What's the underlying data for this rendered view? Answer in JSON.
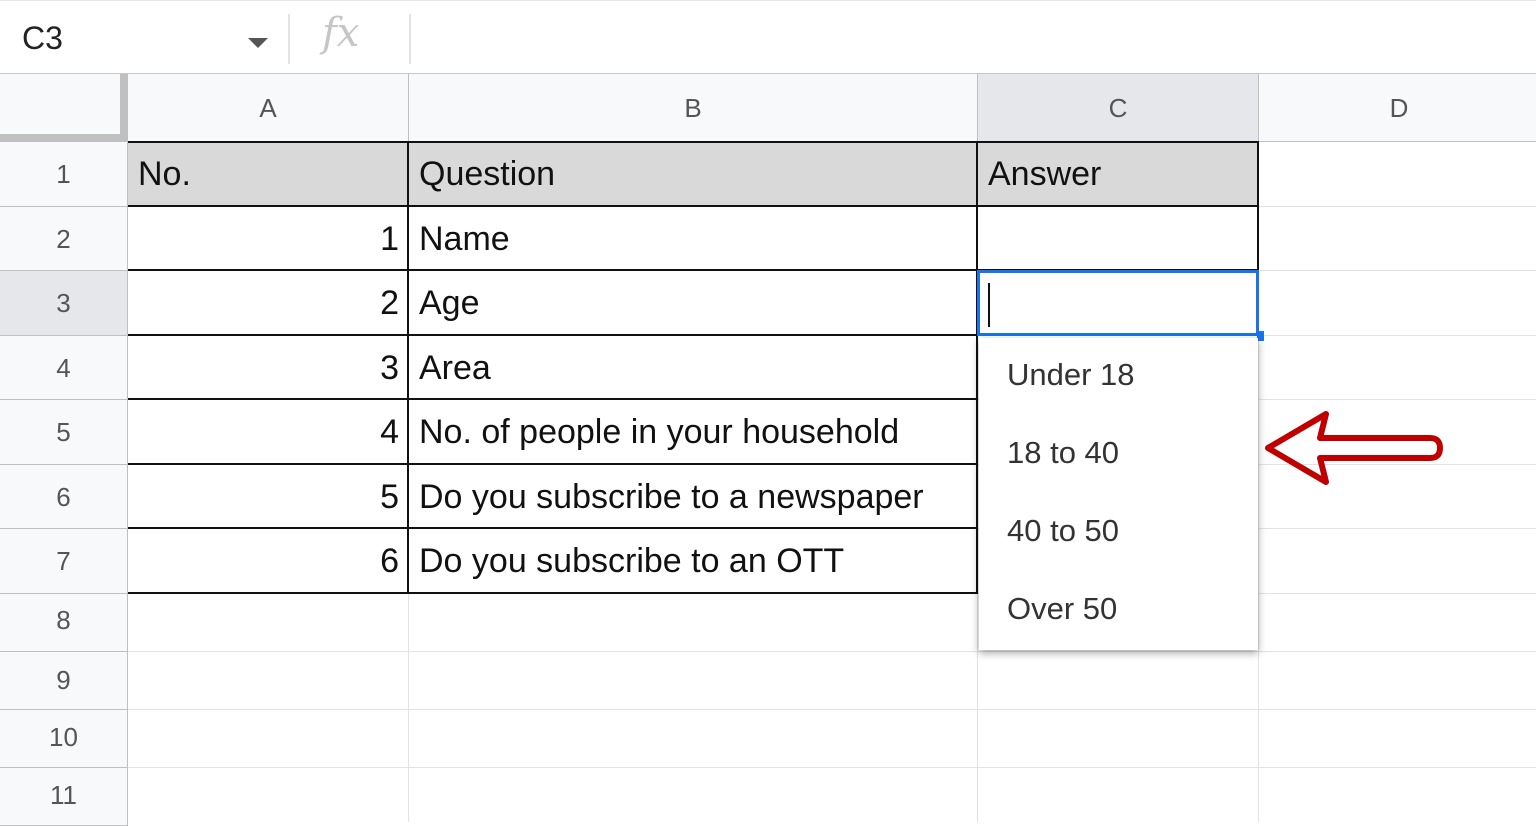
{
  "formula_bar": {
    "name_box": "C3",
    "fx_label": "fx"
  },
  "columns": [
    "A",
    "B",
    "C",
    "D"
  ],
  "rows": [
    "1",
    "2",
    "3",
    "4",
    "5",
    "6",
    "7",
    "8",
    "9",
    "10",
    "11"
  ],
  "table": {
    "headers": [
      "No.",
      "Question",
      "Answer"
    ],
    "rows": [
      {
        "no": "1",
        "question": "Name"
      },
      {
        "no": "2",
        "question": "Age"
      },
      {
        "no": "3",
        "question": "Area"
      },
      {
        "no": "4",
        "question": "No. of people in your household"
      },
      {
        "no": "5",
        "question": "Do you subscribe to a newspaper"
      },
      {
        "no": "6",
        "question": "Do you subscribe to an OTT"
      }
    ]
  },
  "active_cell": "C3",
  "dropdown": {
    "options": [
      "Under 18",
      "18 to 40",
      "40 to 50",
      "Over 50"
    ]
  },
  "colors": {
    "selection": "#1a73e8",
    "arrow": "#c00000",
    "header_fill": "#d9d9d9"
  },
  "icons": {
    "dropdown_caret": "chevron-down-icon",
    "annotation": "arrow-left-icon"
  }
}
